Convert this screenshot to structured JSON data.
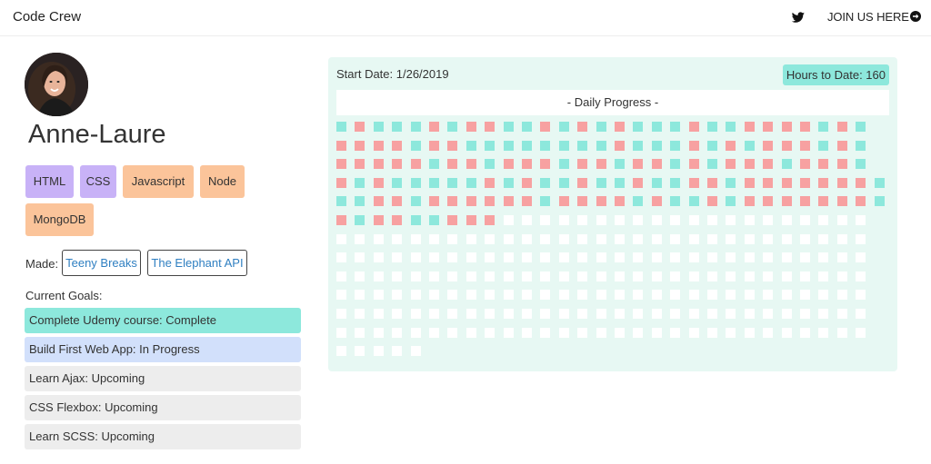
{
  "header": {
    "brand": "Code Crew",
    "twitter_icon": "twitter-icon",
    "join_label": "JOIN US HERE",
    "join_icon": "arrow-circle-right-icon"
  },
  "profile": {
    "name": "Anne-Laure",
    "avatar_icon": "avatar-photo",
    "skills": [
      {
        "label": "HTML",
        "color": "#c8b2f7"
      },
      {
        "label": "CSS",
        "color": "#c8b2f7"
      },
      {
        "label": "Javascript",
        "color": "#fbc49a"
      },
      {
        "label": "Node",
        "color": "#fbc49a"
      },
      {
        "label": "MongoDB",
        "color": "#fbc49a"
      }
    ],
    "made_label": "Made:",
    "made_links": [
      "Teeny Breaks",
      "The Elephant API"
    ],
    "goals_label": "Current Goals:",
    "goals": [
      {
        "text": "Complete Udemy course: Complete",
        "status": "complete"
      },
      {
        "text": "Build First Web App: In Progress",
        "status": "progress"
      },
      {
        "text": "Learn Ajax: Upcoming",
        "status": "upcoming"
      },
      {
        "text": "CSS Flexbox: Upcoming",
        "status": "upcoming"
      },
      {
        "text": "Learn SCSS: Upcoming",
        "status": "upcoming"
      }
    ]
  },
  "progress": {
    "start_date": "Start Date: 1/26/2019",
    "hours": "Hours to Date: 160",
    "title": "- Daily Progress -",
    "colors": {
      "teal": "#8de8dc",
      "pink": "#f7a1a1",
      "empty": "#ffffff"
    },
    "legend_note": "t = teal day, p = pink day, e = empty day",
    "rows": [
      "tptttptppttptptptttpttpppptpt",
      "pppptppttttttttptttptptppptpt",
      "ppppptpptppptpptpptptppptpppt",
      "ptptttttptpttpttpttpptpppppppt",
      "ttpptpppppptpppptpttptpppppppt",
      "ptppttpppeeeeeeeeeeeeeeeeeeee",
      "eeeeeeeeeeeeeeeeeeeeeeeeeeeee",
      "eeeeeeeeeeeeeeeeeeeeeeeeeeeee",
      "eeeeeeeeeeeeeeeeeeeeeeeeeeeee",
      "eeeeeeeeeeeeeeeeeeeeeeeeeeeee",
      "eeeeeeeeeeeeeeeeeeeeeeeeeeeee",
      "eeeeeeeeeeeeeeeeeeeeeeeeeeeee",
      "eeeee"
    ]
  }
}
